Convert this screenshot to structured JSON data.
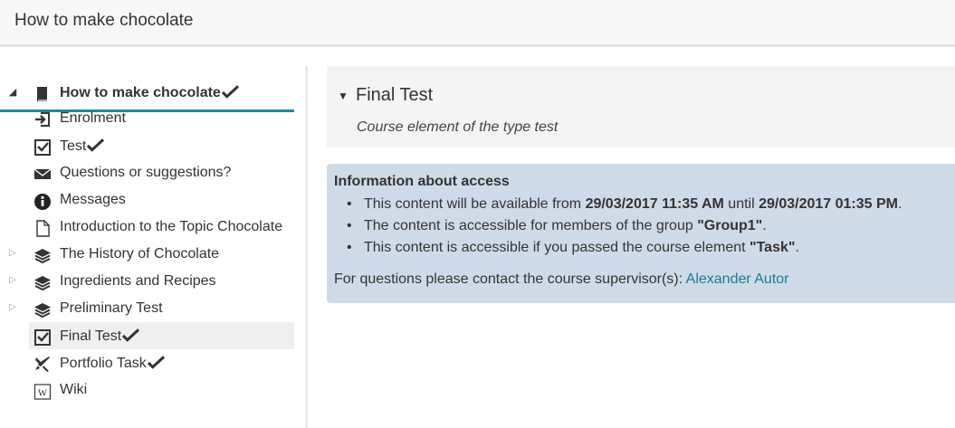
{
  "header": {
    "title": "How to make chocolate"
  },
  "sidebar": {
    "root": {
      "label": "How to make chocolate",
      "passed": true,
      "icon": "course-book-icon"
    },
    "items": [
      {
        "label": "Enrolment",
        "icon": "enrolment-icon",
        "passed": false,
        "expandable": false
      },
      {
        "label": "Test",
        "icon": "test-checkbox-icon",
        "passed": true,
        "expandable": false
      },
      {
        "label": "Questions or suggestions?",
        "icon": "envelope-icon",
        "passed": false,
        "expandable": false
      },
      {
        "label": "Messages",
        "icon": "info-icon",
        "passed": false,
        "expandable": false
      },
      {
        "label": "Introduction to the Topic Chocolate",
        "icon": "page-icon",
        "passed": false,
        "expandable": false
      },
      {
        "label": "The History of Chocolate",
        "icon": "layers-icon",
        "passed": false,
        "expandable": true
      },
      {
        "label": "Ingredients and Recipes",
        "icon": "layers-icon",
        "passed": false,
        "expandable": true
      },
      {
        "label": "Preliminary Test",
        "icon": "layers-icon",
        "passed": false,
        "expandable": true
      },
      {
        "label": "Final Test",
        "icon": "test-checkbox-icon",
        "passed": true,
        "expandable": false,
        "active": true
      },
      {
        "label": "Portfolio Task",
        "icon": "portfolio-icon",
        "passed": true,
        "expandable": false
      },
      {
        "label": "Wiki",
        "icon": "wiki-icon",
        "passed": false,
        "expandable": false
      }
    ]
  },
  "main": {
    "title": "Final Test",
    "description": "Course element of the type test",
    "access": {
      "title": "Information about access",
      "lines": [
        {
          "pre": "This content will be available from ",
          "b1": "29/03/2017 11:35 AM",
          "mid": " until ",
          "b2": "29/03/2017 01:35 PM",
          "post": "."
        },
        {
          "pre": "The content is accessible for members of the group ",
          "b1": "\"Group1\"",
          "post": "."
        },
        {
          "pre": "This content is accessible if you passed the course element ",
          "b1": "\"Task\"",
          "post": "."
        }
      ],
      "contact_text": "For questions please contact the course supervisor(s): ",
      "contact_link": "Alexander Autor"
    }
  },
  "colors": {
    "accent": "#1a8aa3",
    "info_bg": "#cfdae8",
    "link": "#1a7a93"
  }
}
